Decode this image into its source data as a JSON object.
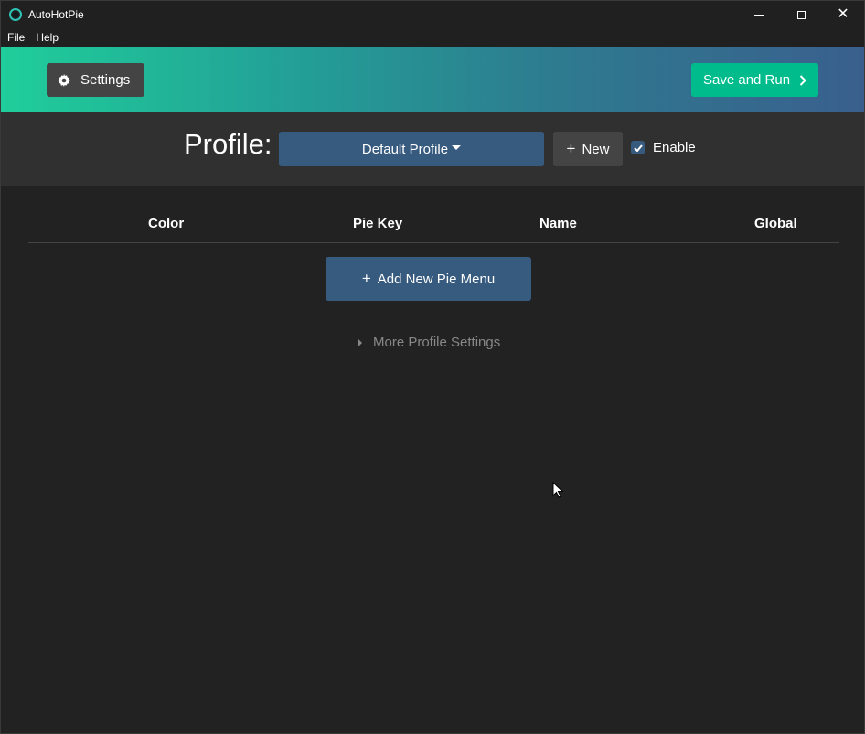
{
  "window": {
    "title": "AutoHotPie",
    "icon": "app-ring-icon"
  },
  "menubar": {
    "items": [
      {
        "label": "File"
      },
      {
        "label": "Help"
      }
    ]
  },
  "header": {
    "settings_label": "Settings",
    "settings_icon": "gear-icon",
    "save_run_label": "Save and Run",
    "save_run_icon": "chevron-right-icon",
    "colors": {
      "settings_bg": "#444444",
      "save_bg": "#00bc8c",
      "gradient_start": "#1fce9a",
      "gradient_end": "#3a5f8e"
    }
  },
  "profile": {
    "label": "Profile:",
    "selected": "Default Profile",
    "new_label": "New",
    "enable_label": "Enable",
    "enabled": true,
    "colors": {
      "select_bg": "#375a7f"
    }
  },
  "table": {
    "columns": [
      "Color",
      "Pie Key",
      "Name",
      "Global"
    ],
    "rows": []
  },
  "actions": {
    "add_pie_menu_label": "Add New Pie Menu",
    "more_settings_label": "More Profile Settings"
  }
}
